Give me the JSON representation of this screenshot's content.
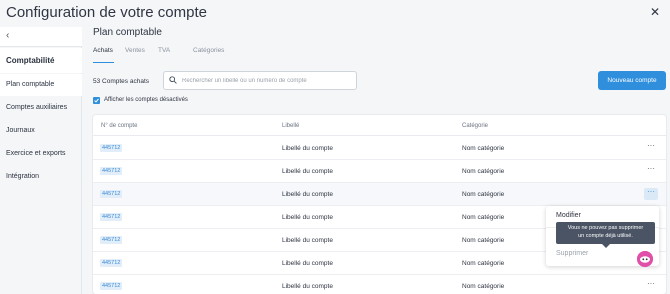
{
  "window": {
    "title": "Configuration de votre compte",
    "close_icon": "close-icon"
  },
  "sidebar": {
    "back_icon": "chevron-left-icon",
    "section": "Comptabilité",
    "items": [
      {
        "label": "Plan comptable",
        "active": true
      },
      {
        "label": "Comptes auxiliaires"
      },
      {
        "label": "Journaux"
      },
      {
        "label": "Exercice et exports"
      },
      {
        "label": "Intégration"
      }
    ]
  },
  "main": {
    "title": "Plan comptable",
    "tabs": [
      {
        "label": "Achats",
        "active": true
      },
      {
        "label": "Ventes"
      },
      {
        "label": "TVA"
      },
      {
        "label": "Catégories"
      }
    ],
    "count": "53 Comptes achats",
    "search": {
      "placeholder": "Rechercher un libellé ou un numéro de compte",
      "value": "",
      "icon": "search-icon"
    },
    "new_button": "Nouveau compte",
    "show_disabled": {
      "label": "Afficher les comptes désactivés",
      "checked": true
    },
    "table": {
      "headers": [
        "N° de compte",
        "Libellé",
        "Catégorie"
      ],
      "rows": [
        {
          "number": "445712",
          "label": "Libellé du compte",
          "category": "Nom catégorie"
        },
        {
          "number": "445712",
          "label": "Libellé du compte",
          "category": "Nom catégorie"
        },
        {
          "number": "445712",
          "label": "Libellé du compte",
          "category": "Nom catégorie"
        },
        {
          "number": "445712",
          "label": "Libellé du compte",
          "category": "Nom catégorie"
        },
        {
          "number": "445712",
          "label": "Libellé du compte",
          "category": "Nom catégorie"
        },
        {
          "number": "445712",
          "label": "Libellé du compte",
          "category": "Nom catégorie"
        },
        {
          "number": "445712",
          "label": "Libellé du compte",
          "category": "Nom catégorie"
        }
      ],
      "more_icon": "ellipsis-icon"
    },
    "menu": {
      "modify": "Modifier",
      "delete": "Supprimer",
      "tooltip_line1": "Vous ne pouvez pas supprimer",
      "tooltip_line2": "un compte déjà utilisé."
    }
  },
  "colors": {
    "accent": "#2f8fdd",
    "badge_bg": "#e1eef9",
    "tooltip_bg": "#4a5464",
    "chat": "#e04fa8"
  }
}
